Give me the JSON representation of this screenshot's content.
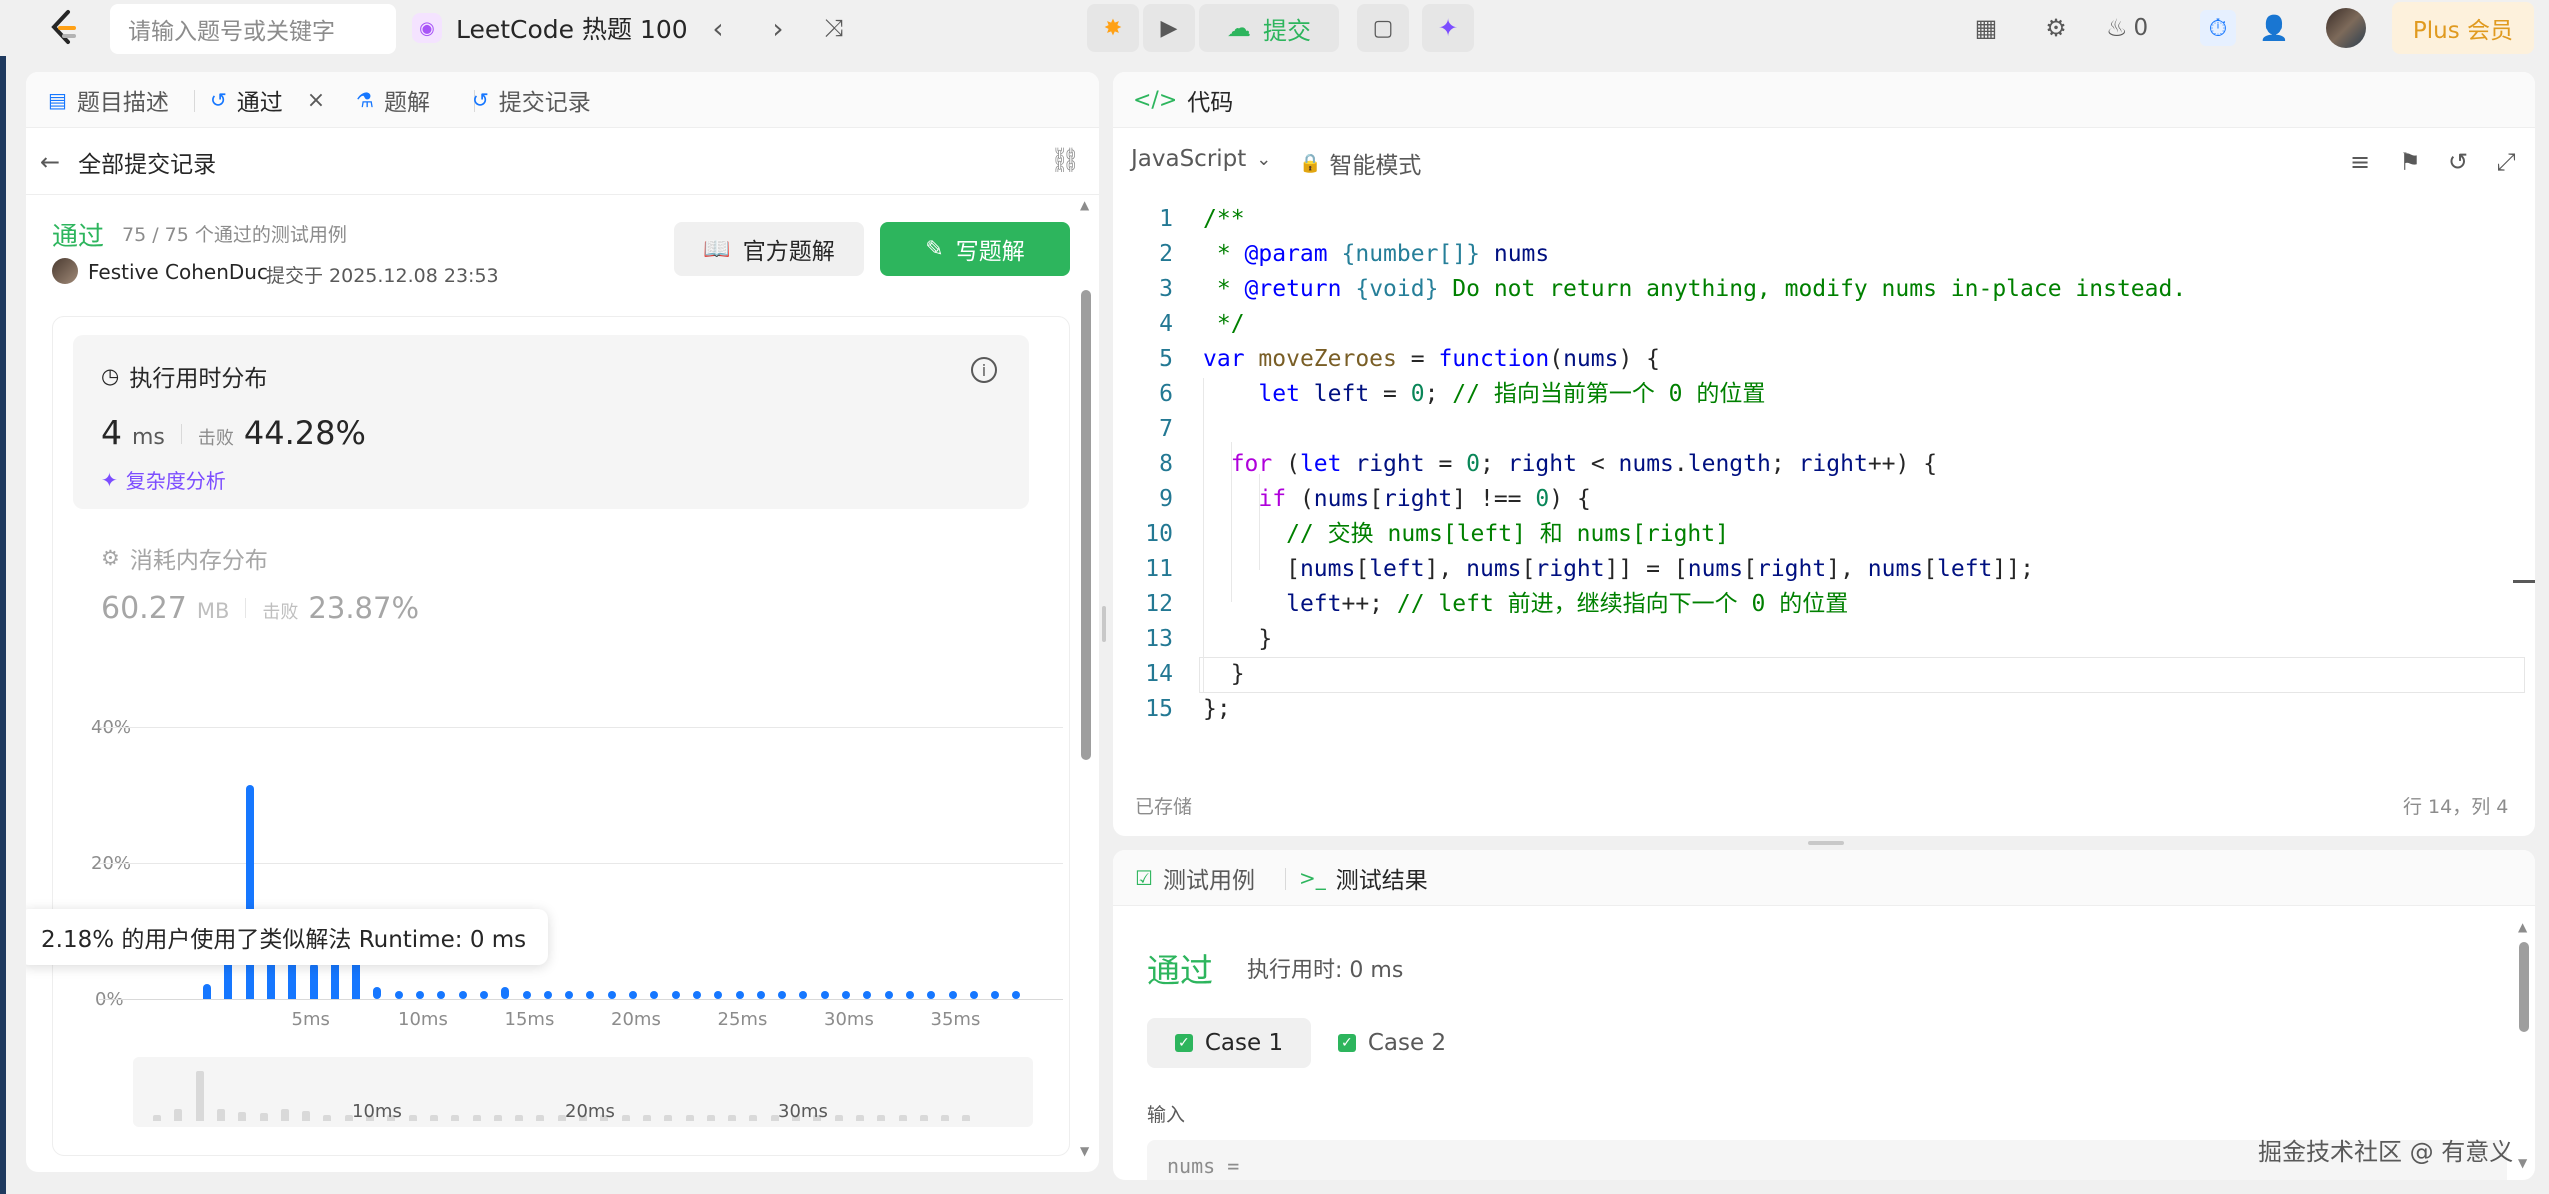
{
  "topbar": {
    "search_placeholder": "请输入题号或关键字",
    "list_title": "LeetCode 热题 100",
    "submit_label": "提交",
    "streak_count": "0",
    "plus_label": "Plus 会员"
  },
  "left_panel": {
    "tabs": [
      "题目描述",
      "通过",
      "题解",
      "提交记录"
    ],
    "back_label": "全部提交记录",
    "status": "通过",
    "cases_passed": "75 / 75 个通过的测试用例",
    "user_name": "Festive CohenDuc",
    "submitted_at": "提交于 2025.12.08 23:53",
    "official_solution_label": "官方题解",
    "write_solution_label": "写题解",
    "runtime": {
      "title": "执行用时分布",
      "value": "4",
      "unit": "ms",
      "beats_label": "击败",
      "beats_value": "44.28%",
      "complexity_label": "复杂度分析"
    },
    "memory": {
      "title": "消耗内存分布",
      "value": "60.27",
      "unit": "MB",
      "beats_label": "击败",
      "beats_value": "23.87%"
    },
    "tooltip": "2.18% 的用户使用了类似解法 Runtime: 0 ms"
  },
  "chart_data": {
    "type": "bar",
    "ylim": [
      0,
      40
    ],
    "y_ticks": [
      "40%",
      "20%",
      "0%"
    ],
    "x_ticks": [
      "5ms",
      "10ms",
      "15ms",
      "20ms",
      "25ms",
      "30ms",
      "35ms"
    ],
    "mini_ticks": [
      "10ms",
      "20ms",
      "30ms"
    ],
    "x": [
      0,
      1,
      2,
      3,
      4,
      5,
      6,
      7,
      8,
      9,
      10,
      11,
      12,
      13,
      14,
      15,
      16,
      17,
      18,
      19,
      20,
      21,
      22,
      23,
      24,
      25,
      26,
      27,
      28,
      29,
      30,
      31,
      32,
      33,
      34,
      35,
      36,
      37,
      38
    ],
    "values": [
      2.18,
      7.5,
      31.5,
      7.8,
      5.9,
      5.3,
      7.8,
      6.4,
      1.8,
      1.2,
      1.2,
      1.2,
      1.2,
      1.2,
      1.8,
      1.2,
      1.2,
      1.2,
      1.2,
      1.2,
      1.2,
      1.2,
      1.2,
      1.2,
      1.2,
      1.2,
      1.2,
      1.2,
      1.2,
      1.2,
      1.2,
      1.2,
      1.2,
      1.2,
      1.2,
      1.2,
      1.2,
      1.2,
      1.2
    ],
    "highlight_index": 2
  },
  "editor": {
    "title": "代码",
    "language": "JavaScript",
    "mode": "智能模式",
    "saved_label": "已存储",
    "cursor_pos": "行 14，列 4",
    "lines": [
      "/**",
      " * @param {number[]} nums",
      " * @return {void} Do not return anything, modify nums in-place instead.",
      " */",
      "var moveZeroes = function(nums) {",
      "    let left = 0; // 指向当前第一个 0 的位置",
      "",
      "  for (let right = 0; right < nums.length; right++) {",
      "    if (nums[right] !== 0) {",
      "      // 交换 nums[left] 和 nums[right]",
      "      [nums[left], nums[right]] = [nums[right], nums[left]];",
      "      left++; // left 前进，继续指向下一个 0 的位置",
      "    }",
      "  }",
      "};"
    ]
  },
  "test_panel": {
    "tab_cases": "测试用例",
    "tab_results": "测试结果",
    "status": "通过",
    "runtime": "执行用时: 0 ms",
    "cases": [
      "Case 1",
      "Case 2"
    ],
    "input_label": "输入",
    "input_preview": "nums ="
  },
  "watermark": "掘金技术社区 @ 有意义"
}
